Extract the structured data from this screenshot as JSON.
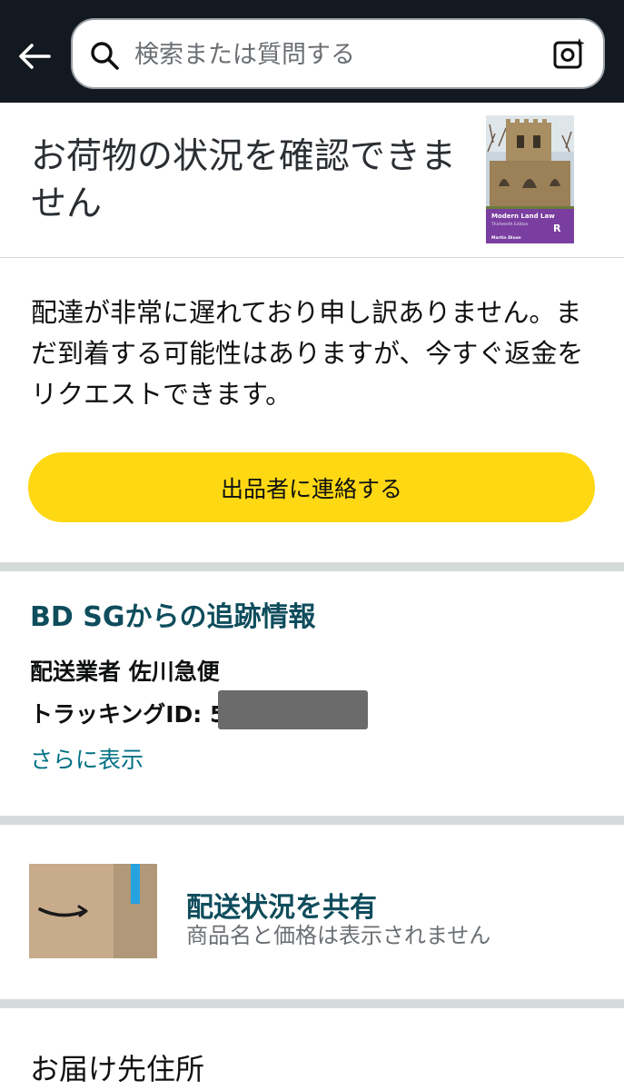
{
  "header": {
    "search_placeholder": "検索または質問する"
  },
  "status": {
    "title": "お荷物の状況を確認できません",
    "book_cover": {
      "title": "Modern Land Law",
      "edition": "Thirteenth Edition",
      "author": "Martin Dixon",
      "publisher_mark": "R"
    }
  },
  "notice": {
    "message": "配達が非常に遅れており申し訳ありません。まだ到着する可能性はありますが、今すぐ返金をリクエストできます。",
    "contact_seller_label": "出品者に連絡する"
  },
  "tracking": {
    "title": "BD SGからの追跡情報",
    "carrier_line": "配送業者 佐川急便",
    "tracking_id_line": "トラッキングID: 5                    1",
    "show_more_label": "さらに表示"
  },
  "share": {
    "title": "配送状況を共有",
    "subtitle": "商品名と価格は表示されません"
  },
  "address": {
    "heading": "お届け先住所"
  },
  "colors": {
    "topbar": "#131921",
    "button_yellow": "#ffd814",
    "heading_teal": "#0f4d5c",
    "link_teal": "#007185",
    "divider": "#d5dbdb"
  }
}
